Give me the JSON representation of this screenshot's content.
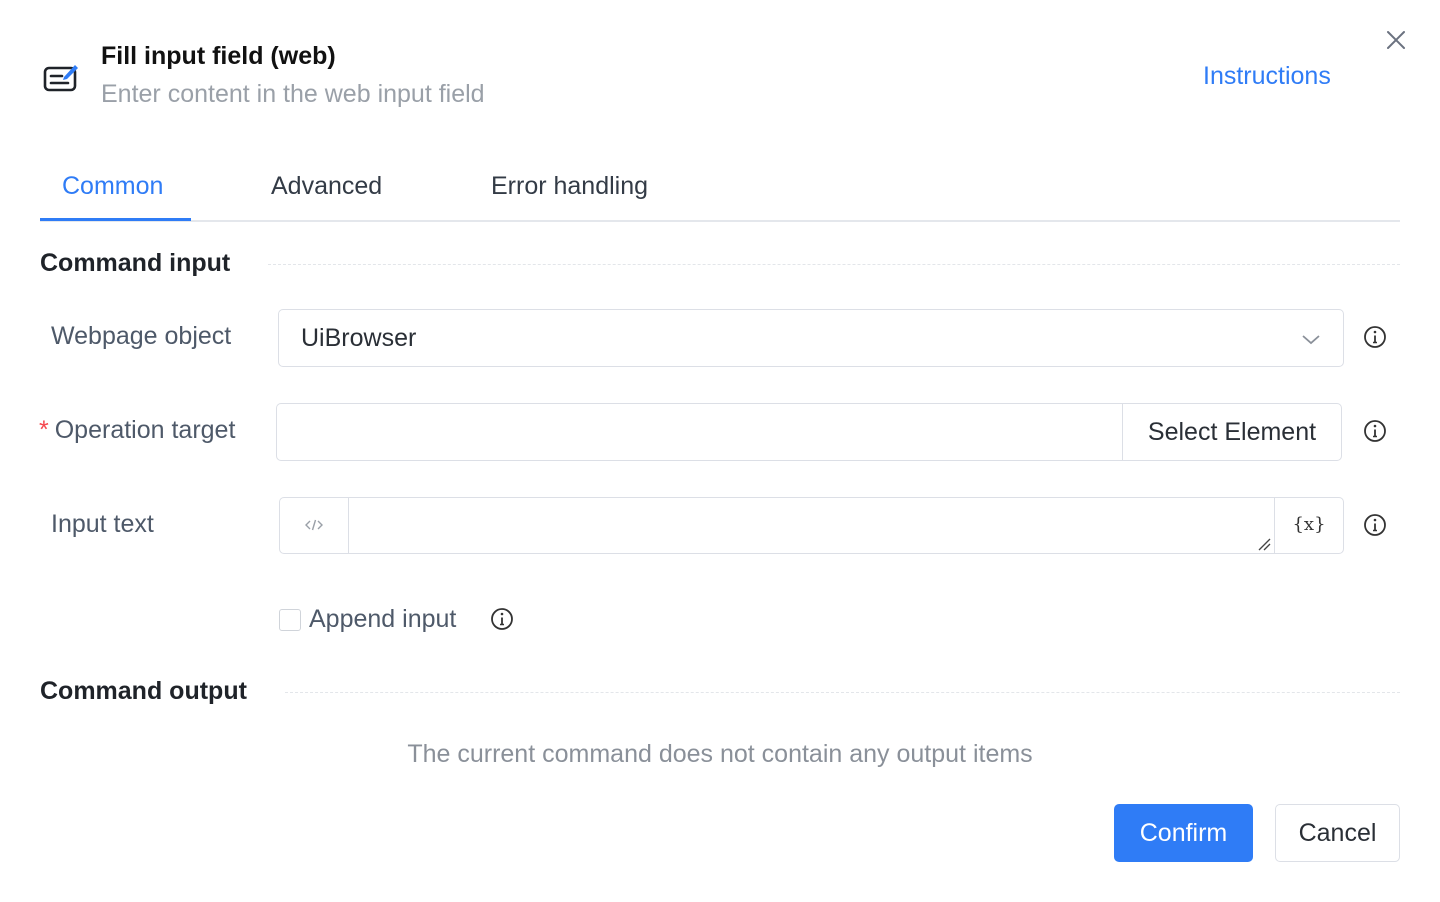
{
  "header": {
    "icon": "edit-input-icon",
    "title": "Fill input field (web)",
    "subtitle": "Enter content in the web input field",
    "instructions_link": "Instructions",
    "close_icon": "close-icon"
  },
  "tabs": [
    {
      "label": "Common",
      "active": true
    },
    {
      "label": "Advanced",
      "active": false
    },
    {
      "label": "Error handling",
      "active": false
    }
  ],
  "command_input": {
    "section_title": "Command input",
    "webpage_object": {
      "label": "Webpage object",
      "value": "UiBrowser"
    },
    "operation_target": {
      "required_mark": "*",
      "label": "Operation target",
      "value": "",
      "button_label": "Select Element"
    },
    "input_text": {
      "label": "Input text",
      "value": "",
      "variable_button": "{x}"
    },
    "append_input": {
      "label": "Append input",
      "checked": false
    }
  },
  "command_output": {
    "section_title": "Command output",
    "empty_message": "The current command does not contain any output items"
  },
  "footer": {
    "confirm_label": "Confirm",
    "cancel_label": "Cancel"
  },
  "colors": {
    "accent": "#2f7cf6",
    "required": "#f5484f"
  }
}
